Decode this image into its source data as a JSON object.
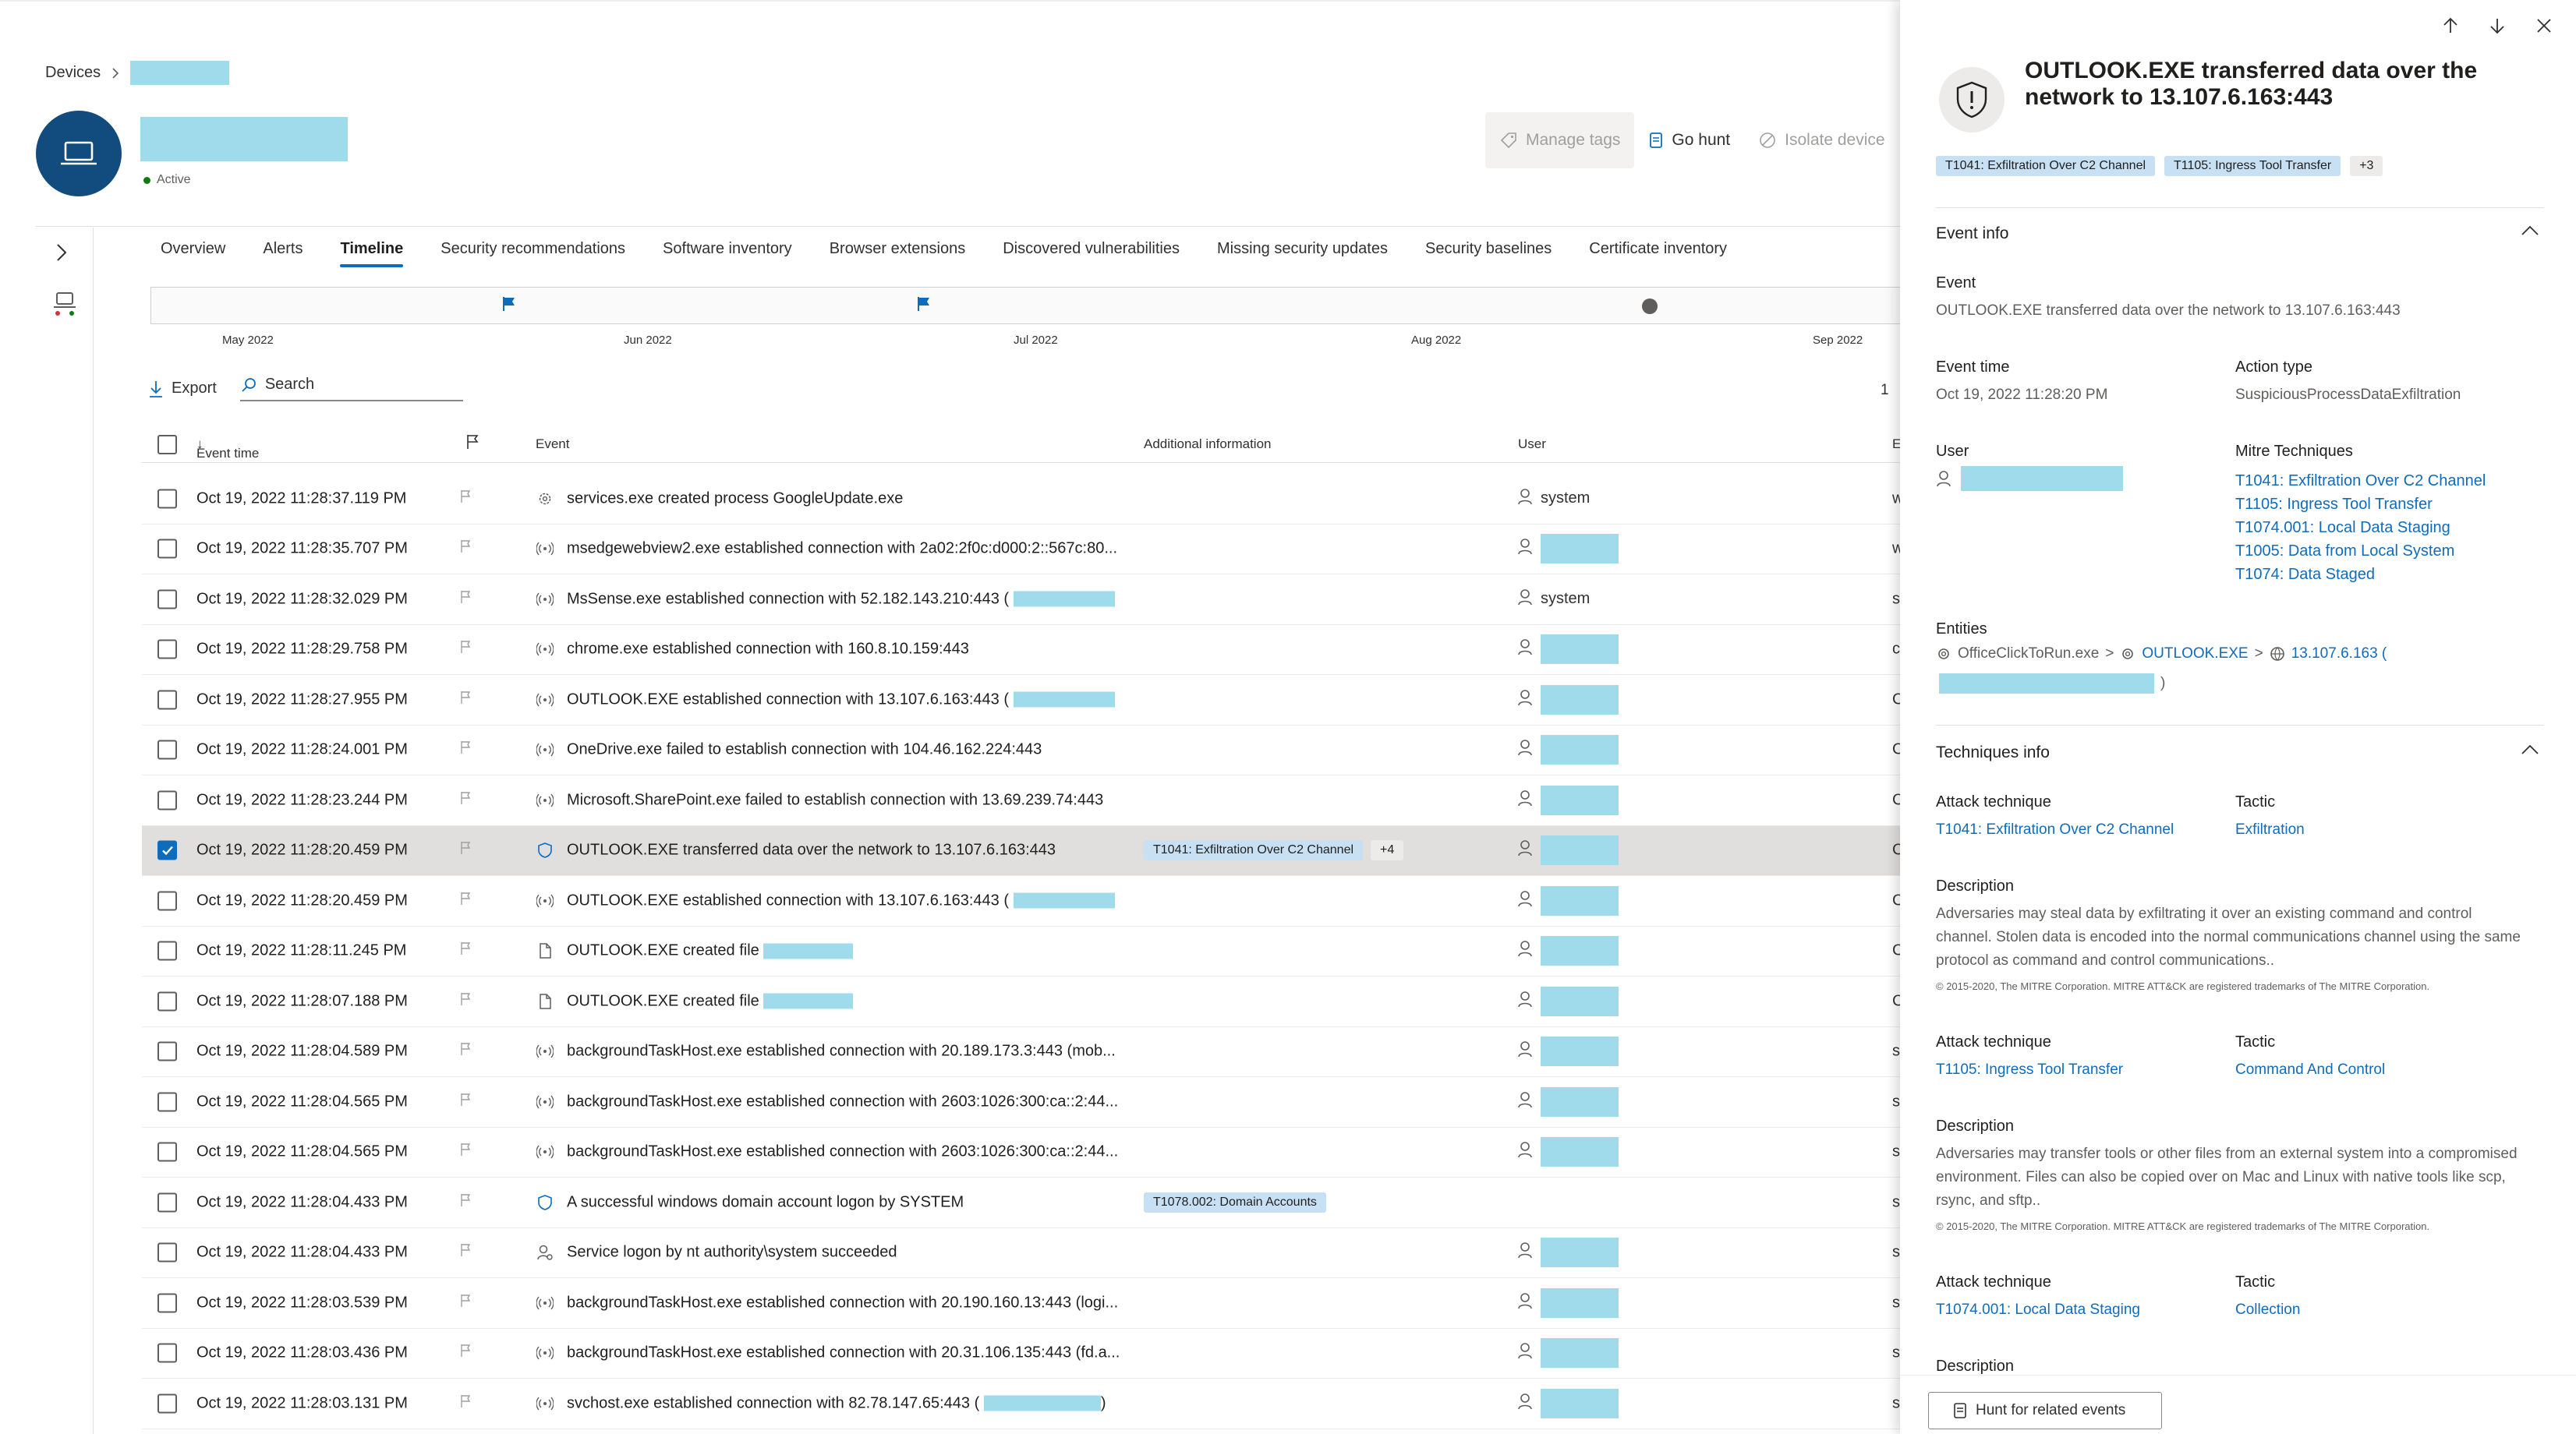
{
  "breadcrumb": {
    "root": "Devices"
  },
  "device": {
    "status": "Active"
  },
  "actions": {
    "manage_tags": "Manage tags",
    "go_hunt": "Go hunt",
    "isolate": "Isolate device"
  },
  "tabs": [
    "Overview",
    "Alerts",
    "Timeline",
    "Security recommendations",
    "Software inventory",
    "Browser extensions",
    "Discovered vulnerabilities",
    "Missing security updates",
    "Security baselines",
    "Certificate inventory"
  ],
  "timeline": {
    "months": [
      "May 2022",
      "Jun 2022",
      "Jul 2022",
      "Aug 2022",
      "Sep 2022"
    ]
  },
  "toolbar": {
    "export": "Export",
    "search": "Search",
    "page": "1"
  },
  "table": {
    "headers": {
      "event_time": "Event time",
      "event": "Event",
      "additional": "Additional information",
      "user": "User",
      "last": "E"
    },
    "rows": [
      {
        "time": "Oct 19, 2022 11:28:37.119 PM",
        "icon": "gear",
        "event": "services.exe created process GoogleUpdate.exe",
        "user": "system",
        "last": "w"
      },
      {
        "time": "Oct 19, 2022 11:28:35.707 PM",
        "icon": "network",
        "event": "msedgewebview2.exe established connection with 2a02:2f0c:d000:2::567c:80...",
        "last": "w"
      },
      {
        "time": "Oct 19, 2022 11:28:32.029 PM",
        "icon": "network",
        "event": "MsSense.exe established connection with 52.182.143.210:443 (",
        "redact": 130,
        "user": "system",
        "last": "s"
      },
      {
        "time": "Oct 19, 2022 11:28:29.758 PM",
        "icon": "network",
        "event": "chrome.exe established connection with 160.8.10.159:443",
        "last": "c"
      },
      {
        "time": "Oct 19, 2022 11:28:27.955 PM",
        "icon": "network",
        "event": "OUTLOOK.EXE established connection with 13.107.6.163:443 (",
        "redact": 130,
        "last": "C"
      },
      {
        "time": "Oct 19, 2022 11:28:24.001 PM",
        "icon": "network",
        "event": "OneDrive.exe failed to establish connection with 104.46.162.224:443",
        "last": "C"
      },
      {
        "time": "Oct 19, 2022 11:28:23.244 PM",
        "icon": "network",
        "event": "Microsoft.SharePoint.exe failed to establish connection with 13.69.239.74:443",
        "last": "C"
      },
      {
        "time": "Oct 19, 2022 11:28:20.459 PM",
        "icon": "shield",
        "event": "OUTLOOK.EXE transferred data over the network to 13.107.6.163:443",
        "badges": [
          "T1041: Exfiltration Over C2 Channel",
          "+4"
        ],
        "selected": true,
        "last": "C"
      },
      {
        "time": "Oct 19, 2022 11:28:20.459 PM",
        "icon": "network",
        "event": "OUTLOOK.EXE established connection with 13.107.6.163:443 (",
        "redact": 130,
        "last": "C"
      },
      {
        "time": "Oct 19, 2022 11:28:11.245 PM",
        "icon": "file",
        "event": "OUTLOOK.EXE created file",
        "redact": 115,
        "last": "C"
      },
      {
        "time": "Oct 19, 2022 11:28:07.188 PM",
        "icon": "file",
        "event": "OUTLOOK.EXE created file",
        "redact": 115,
        "last": "C"
      },
      {
        "time": "Oct 19, 2022 11:28:04.589 PM",
        "icon": "network",
        "event": "backgroundTaskHost.exe established connection with 20.189.173.3:443 (mob...",
        "last": "s"
      },
      {
        "time": "Oct 19, 2022 11:28:04.565 PM",
        "icon": "network",
        "event": "backgroundTaskHost.exe established connection with 2603:1026:300:ca::2:44...",
        "last": "s"
      },
      {
        "time": "Oct 19, 2022 11:28:04.565 PM",
        "icon": "network",
        "event": "backgroundTaskHost.exe established connection with 2603:1026:300:ca::2:44...",
        "last": "s"
      },
      {
        "time": "Oct 19, 2022 11:28:04.433 PM",
        "icon": "shield",
        "event": "A successful windows domain account logon by SYSTEM",
        "badges": [
          "T1078.002: Domain Accounts"
        ],
        "nouser": true,
        "last": "s"
      },
      {
        "time": "Oct 19, 2022 11:28:04.433 PM",
        "icon": "logon",
        "event": "Service logon by nt authority\\system succeeded",
        "last": "s"
      },
      {
        "time": "Oct 19, 2022 11:28:03.539 PM",
        "icon": "network",
        "event": "backgroundTaskHost.exe established connection with 20.190.160.13:443 (logi...",
        "last": "s"
      },
      {
        "time": "Oct 19, 2022 11:28:03.436 PM",
        "icon": "network",
        "event": "backgroundTaskHost.exe established connection with 20.31.106.135:443 (fd.a...",
        "last": "s"
      },
      {
        "time": "Oct 19, 2022 11:28:03.131 PM",
        "icon": "network",
        "event": "svchost.exe established connection with 82.78.147.65:443 (",
        "redact": 150,
        "close": ")",
        "last": "s"
      }
    ]
  },
  "panel": {
    "title": "OUTLOOK.EXE transferred data over the network to 13.107.6.163:443",
    "tags": [
      "T1041: Exfiltration Over C2 Channel",
      "T1105: Ingress Tool Transfer",
      "+3"
    ],
    "event_info": "Event info",
    "event_label": "Event",
    "event_value": "OUTLOOK.EXE transferred data over the network to 13.107.6.163:443",
    "event_time_label": "Event time",
    "event_time": "Oct 19, 2022 11:28:20 PM",
    "action_type_label": "Action type",
    "action_type": "SuspiciousProcessDataExfiltration",
    "user_label": "User",
    "mitre_label": "Mitre Techniques",
    "mitre": [
      "T1041: Exfiltration Over C2 Channel",
      "T1105: Ingress Tool Transfer",
      "T1074.001: Local Data Staging",
      "T1005: Data from Local System",
      "T1074: Data Staged"
    ],
    "entities_label": "Entities",
    "entities": {
      "e1": "OfficeClickToRun.exe",
      "sep": ">",
      "e2": "OUTLOOK.EXE",
      "e3": "13.107.6.163 (",
      "close": ")"
    },
    "techniques_info": "Techniques info",
    "attack_label": "Attack technique",
    "tactic_label": "Tactic",
    "description_label": "Description",
    "tech1": {
      "attack": "T1041: Exfiltration Over C2 Channel",
      "tactic": "Exfiltration",
      "desc": "Adversaries may steal data by exfiltrating it over an existing command and control channel. Stolen data is encoded into the normal communications channel using the same protocol as command and control communications.."
    },
    "tech2": {
      "attack": "T1105: Ingress Tool Transfer",
      "tactic": "Command And Control",
      "desc": "Adversaries may transfer tools or other files from an external system into a compromised environment. Files can also be copied over on Mac and Linux with native tools like scp, rsync, and sftp.."
    },
    "tech3": {
      "attack": "T1074.001: Local Data Staging",
      "tactic": "Collection"
    },
    "copyright": "© 2015-2020, The MITRE Corporation. MITRE ATT&CK are registered trademarks of The MITRE Corporation.",
    "hunt_button": "Hunt for related events"
  }
}
